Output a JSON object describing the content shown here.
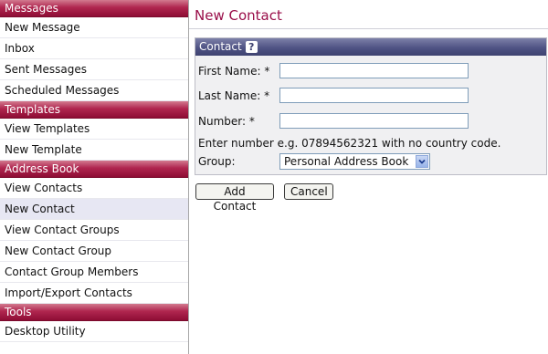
{
  "sidebar": {
    "sections": [
      {
        "title": "Messages",
        "items": [
          "New Message",
          "Inbox",
          "Sent Messages",
          "Scheduled Messages"
        ]
      },
      {
        "title": "Templates",
        "items": [
          "View Templates",
          "New Template"
        ]
      },
      {
        "title": "Address Book",
        "items": [
          "View Contacts",
          "New Contact",
          "View Contact Groups",
          "New Contact Group",
          "Contact Group Members",
          "Import/Export Contacts"
        ]
      },
      {
        "title": "Tools",
        "items": [
          "Desktop Utility"
        ]
      }
    ],
    "active_item": "New Contact"
  },
  "main": {
    "title": "New Contact",
    "panel": {
      "header": "Contact",
      "help_icon": "?",
      "first_name_label": "First Name: *",
      "first_name_value": "",
      "last_name_label": "Last Name: *",
      "last_name_value": "",
      "number_label": "Number: *",
      "number_value": "",
      "hint": "Enter number e.g. 07894562321 with no country code.",
      "group_label": "Group:",
      "group_value": "Personal Address Book"
    },
    "buttons": {
      "add_contact": "Add Contact",
      "cancel": "Cancel"
    }
  },
  "colors": {
    "section_header": "#a0194a",
    "panel_header": "#4f5384",
    "title": "#9a0f4a",
    "active_bg": "#e7e7f3"
  }
}
